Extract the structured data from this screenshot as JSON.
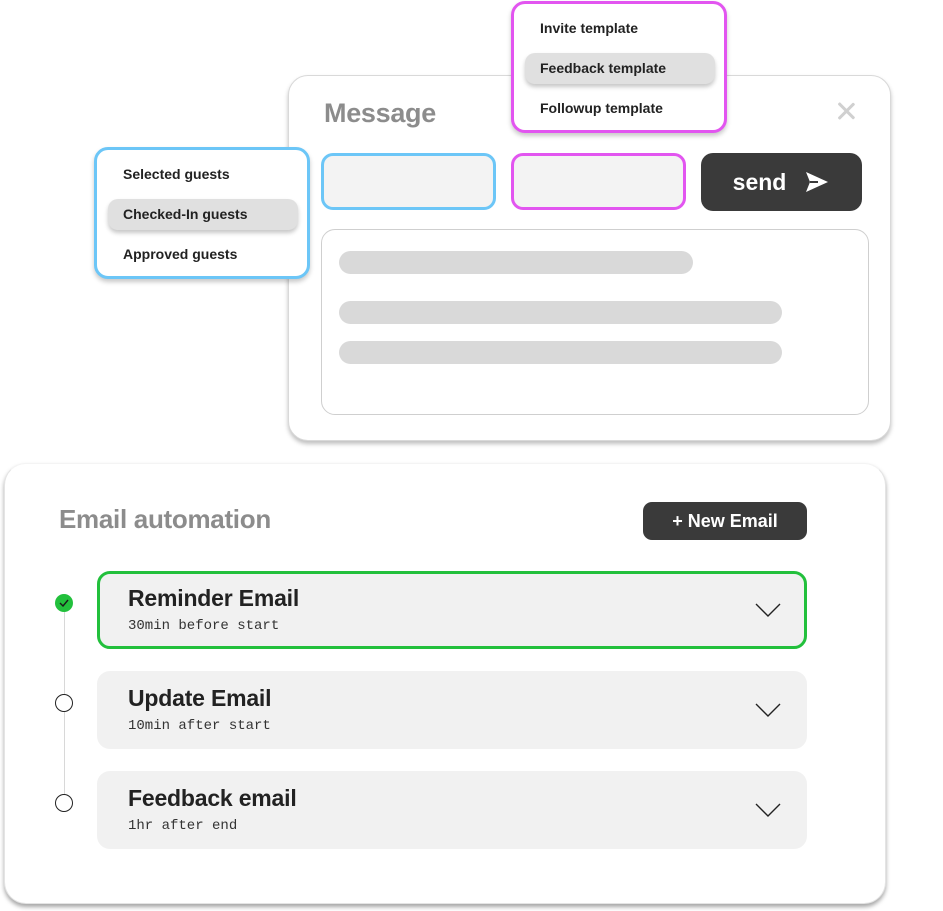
{
  "message_panel": {
    "title": "Message",
    "close_icon": "close-icon",
    "recipients_field": {
      "value": "",
      "placeholder": ""
    },
    "template_field": {
      "value": "",
      "placeholder": ""
    },
    "send_button": {
      "label": "send",
      "icon": "send-icon"
    },
    "body": {
      "value": "",
      "placeholder_lines": 3
    }
  },
  "template_dropdown": {
    "items": [
      {
        "label": "Invite template",
        "selected": false
      },
      {
        "label": "Feedback template",
        "selected": true
      },
      {
        "label": "Followup template",
        "selected": false
      }
    ]
  },
  "guests_dropdown": {
    "items": [
      {
        "label": "Selected guests",
        "selected": false
      },
      {
        "label": "Checked-In guests",
        "selected": true
      },
      {
        "label": "Approved guests",
        "selected": false
      }
    ]
  },
  "automation": {
    "title": "Email automation",
    "new_button": "+ New Email",
    "emails": [
      {
        "name": "Reminder Email",
        "timing": "30min before start",
        "status": "done",
        "active": true
      },
      {
        "name": "Update Email",
        "timing": "10min after start",
        "status": "pending",
        "active": false
      },
      {
        "name": "Feedback email",
        "timing": "1hr after end",
        "status": "pending",
        "active": false
      }
    ]
  },
  "colors": {
    "guests_accent": "#6cc6f7",
    "template_accent": "#e255f0",
    "success": "#22c03c",
    "button_dark": "#3a3a3a",
    "title_gray": "#8c8c8c"
  }
}
